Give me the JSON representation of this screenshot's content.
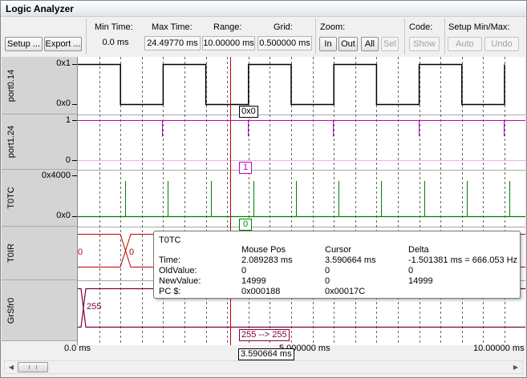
{
  "window": {
    "title": "Logic Analyzer"
  },
  "toolbar": {
    "setup_label": "Setup ...",
    "export_label": "Export ...",
    "min_time_label": "Min Time:",
    "min_time_value": "0.0 ms",
    "max_time_label": "Max Time:",
    "max_time_value": "24.49770 ms",
    "range_label": "Range:",
    "range_value": "10.00000 ms",
    "grid_label": "Grid:",
    "grid_value": "0.500000 ms",
    "zoom_label": "Zoom:",
    "zoom_in": "In",
    "zoom_out": "Out",
    "zoom_all": "All",
    "zoom_sel": "Sel",
    "code_label": "Code:",
    "code_show": "Show",
    "setup_minmax_label": "Setup Min/Max:",
    "auto_label": "Auto",
    "undo_label": "Undo"
  },
  "lanes": [
    {
      "name": "port0.14",
      "top_tick": "0x1",
      "bottom_tick": "0x0"
    },
    {
      "name": "port1.24",
      "top_tick": "1",
      "bottom_tick": "0"
    },
    {
      "name": "T0TC",
      "top_tick": "0x4000",
      "bottom_tick": "0x0"
    },
    {
      "name": "T0IR",
      "top_tick": "",
      "bottom_tick": ""
    },
    {
      "name": "GrSfr0",
      "top_tick": "",
      "bottom_tick": ""
    }
  ],
  "cursor_values": {
    "port0": "0x0",
    "port1": "1",
    "t0tc": "0",
    "t0ir_left": "0",
    "t0ir_mid": "0",
    "grsfr": "255",
    "grsfr_change": "255 --> 255"
  },
  "xaxis": {
    "start": "0.0 ms",
    "mid": "5.000000 ms",
    "end": "10.00000 ms",
    "cursor": "3.590664 ms"
  },
  "tooltip": {
    "signal": "T0TC",
    "col_mouse": "Mouse Pos",
    "col_cursor": "Cursor",
    "col_delta": "Delta",
    "row_time": "Time:",
    "row_old": "OldValue:",
    "row_new": "NewValue:",
    "row_pc": "PC $:",
    "time_mouse": "2.089283 ms",
    "time_cursor": "3.590664 ms",
    "time_delta": "-1.501381 ms = 666.053 Hz",
    "old_mouse": "0",
    "old_cursor": "0",
    "old_delta": "0",
    "new_mouse": "14999",
    "new_cursor": "0",
    "new_delta": "14999",
    "pc_mouse": "0x000188",
    "pc_cursor": "0x00017C"
  },
  "colors": {
    "port0": "#000000",
    "port1": "#c000c0",
    "t0tc": "#008000",
    "t0ir": "#c00000",
    "grsfr": "#800040",
    "cursor": "#c00000",
    "grid": "#000000"
  },
  "chart_data": {
    "type": "line",
    "x_unit": "ms",
    "xlim": [
      0,
      10
    ],
    "grid_step": 0.5,
    "cursor_time": 3.590664,
    "series": [
      {
        "name": "port0.14",
        "kind": "digital",
        "low_intervals": [
          [
            1.0,
            2.0
          ],
          [
            3.0,
            4.0
          ],
          [
            5.0,
            6.0
          ],
          [
            7.0,
            8.0
          ],
          [
            9.0,
            10.0
          ]
        ]
      },
      {
        "name": "port1.24",
        "kind": "pulses",
        "level": 1,
        "pulse_times": [
          2.0,
          4.0,
          6.0,
          8.0,
          10.0
        ]
      },
      {
        "name": "T0TC",
        "kind": "spikes",
        "spike_times": [
          1.0,
          2.0,
          3.0,
          4.0,
          5.0,
          6.0,
          7.0,
          8.0,
          9.0,
          10.0
        ],
        "spike_value": 14999
      }
    ]
  }
}
